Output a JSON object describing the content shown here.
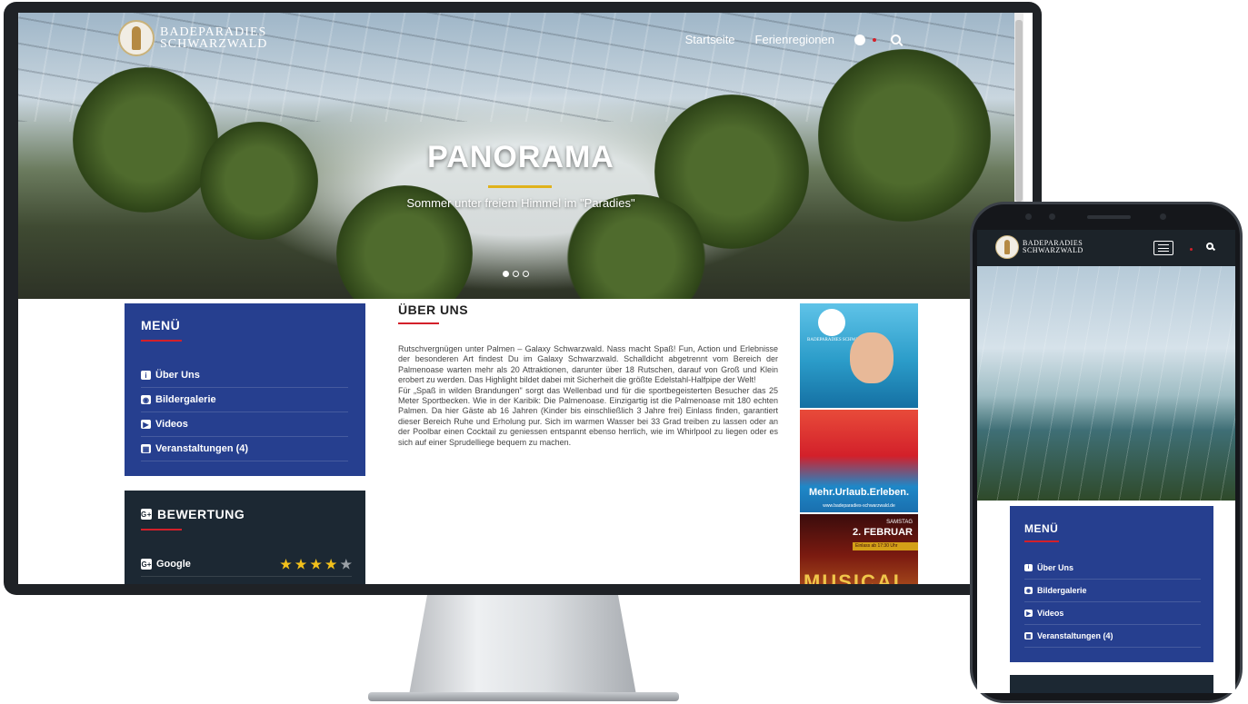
{
  "desktop": {
    "logo": {
      "line1": "BADEPARADIES",
      "line2": "SCHWARZWALD"
    },
    "nav": [
      {
        "label": "Startseite"
      },
      {
        "label": "Ferienregionen"
      }
    ],
    "hero": {
      "title": "PANORAMA",
      "subtitle": "Sommer unter freiem Himmel im \"Paradies\"",
      "slides_total": 3,
      "active_slide": 1
    },
    "menu": {
      "title": "MENÜ",
      "items": [
        {
          "label": "Über Uns",
          "icon": "info-circle-icon"
        },
        {
          "label": "Bildergalerie",
          "icon": "camera-icon"
        },
        {
          "label": "Videos",
          "icon": "video-camera-icon"
        },
        {
          "label": "Veranstaltungen  (4)",
          "icon": "calendar-icon"
        }
      ]
    },
    "rating": {
      "title": "BEWERTUNG",
      "rows": [
        {
          "label": "Google",
          "stars": 4,
          "max": 5
        }
      ]
    },
    "about": {
      "title": "ÜBER UNS",
      "paragraph1": "Rutschvergnügen unter Palmen – Galaxy Schwarzwald. Nass macht Spaß! Fun, Action und Erlebnisse der besonderen Art findest Du im Galaxy Schwarzwald. Schalldicht abgetrennt vom Bereich der Palmenoase warten mehr als 20 Attraktionen, darunter über 18 Rutschen, darauf von Groß und Klein erobert zu werden. Das Highlight bildet dabei mit Sicherheit die größte Edelstahl-Halfpipe der Welt!",
      "paragraph2": "Für „Spaß in wilden Brandungen\" sorgt das Wellenbad und für die sportbegeisterten Besucher das 25 Meter Sportbecken. Wie in der Karibik: Die Palmenoase. Einzigartig ist die Palmenoase mit 180 echten Palmen. Da hier Gäste ab 16 Jahren (Kinder bis einschließlich 3 Jahre frei) Einlass finden, garantiert dieser Bereich Ruhe und Erholung pur. Sich im warmen Wasser bei 33 Grad treiben zu lassen oder an der Poolbar einen Cocktail zu geniessen entspannt ebenso herrlich, wie im Whirlpool zu liegen oder es sich auf einer Sprudelliege bequem zu machen."
    },
    "ads": {
      "ad1_logo": "BADEPARADIES SCHWARZWALD",
      "ad2_cta": "Mehr.Urlaub.Erleben.",
      "ad2_url": "www.badeparadies-schwarzwald.de",
      "ad3_day": "SAMSTAG",
      "ad3_date": "2. FEBRUAR",
      "ad3_band": "Einlass ab 17:30 Uhr",
      "ad3_title": "MUSICAL"
    }
  },
  "mobile": {
    "logo": {
      "line1": "BADEPARADIES",
      "line2": "SCHWARZWALD"
    },
    "menu": {
      "title": "MENÜ",
      "items": [
        {
          "label": "Über Uns",
          "icon": "info-circle-icon"
        },
        {
          "label": "Bildergalerie",
          "icon": "camera-icon"
        },
        {
          "label": "Videos",
          "icon": "video-camera-icon"
        },
        {
          "label": "Veranstaltungen  (4)",
          "icon": "calendar-icon"
        }
      ]
    }
  },
  "colors": {
    "menu_blue": "#263f8f",
    "dark_panel": "#1c2833",
    "accent_red": "#d3202a",
    "hero_gold": "#e0b21c",
    "star_gold": "#f2c01b"
  }
}
